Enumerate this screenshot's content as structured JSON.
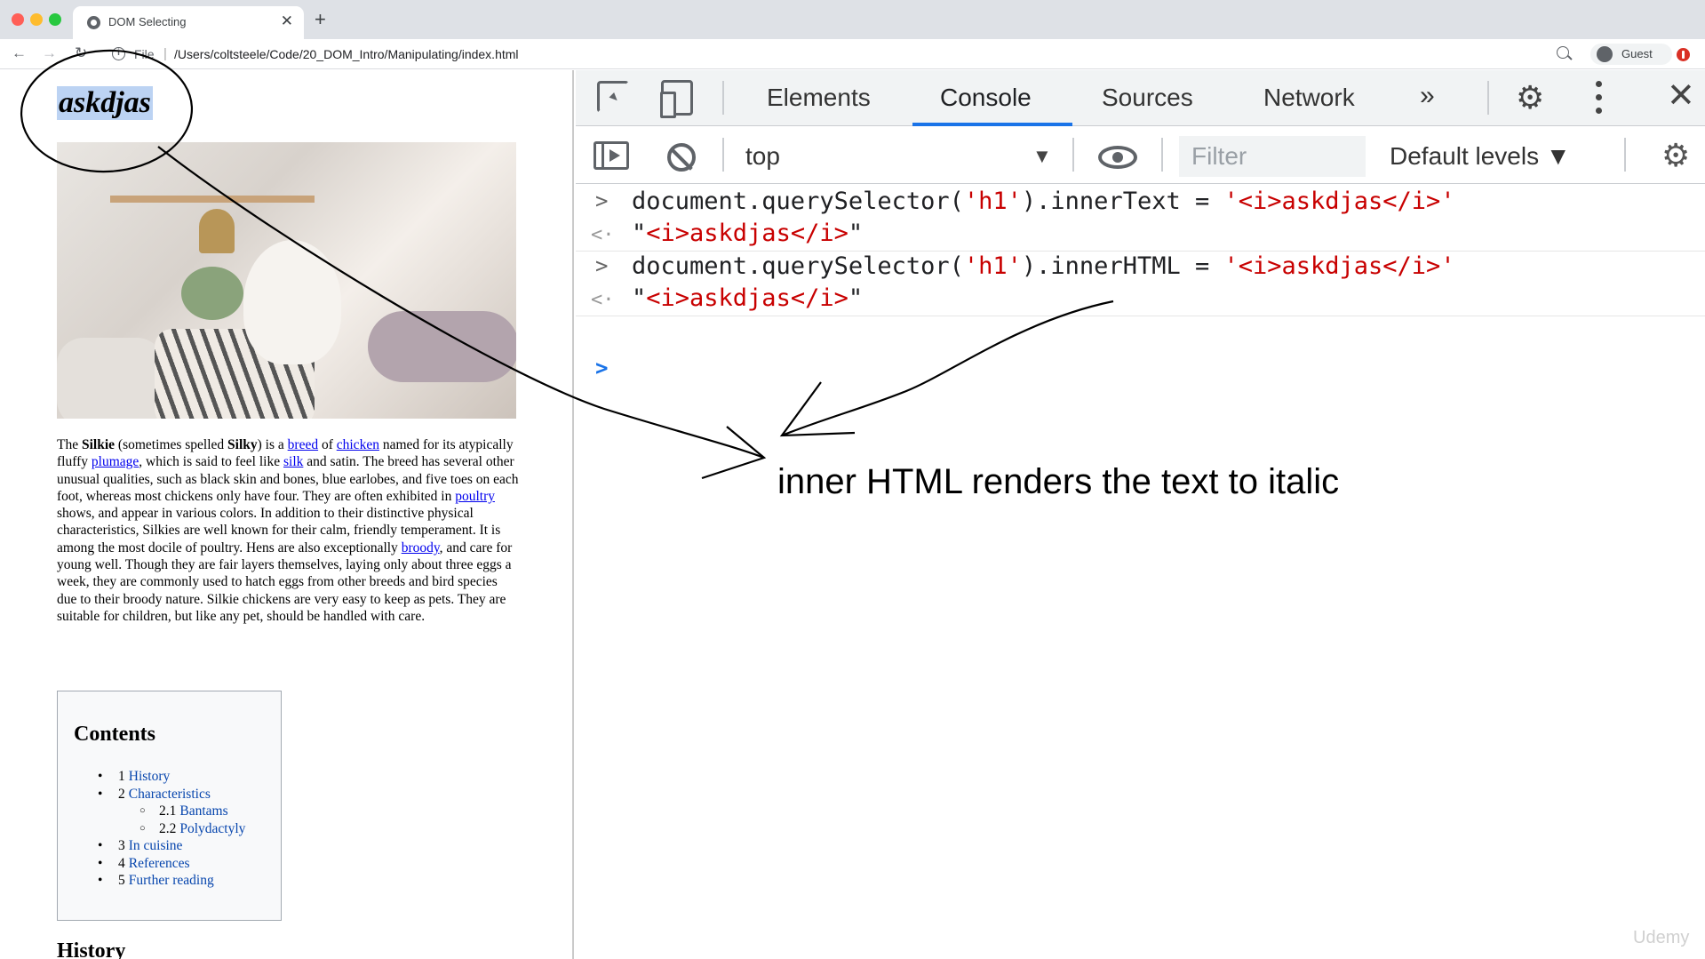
{
  "browser": {
    "tab_title": "DOM Selecting",
    "tab_close": "✕",
    "new_tab": "+",
    "file_label": "File",
    "url": "/Users/coltsteele/Code/20_DOM_Intro/Manipulating/index.html",
    "profile_name": "Guest"
  },
  "page": {
    "h1": "askdjas",
    "article_html": "The <b>Silkie</b> (sometimes spelled <b>Silky</b>) is a <a>breed</a> of <a>chicken</a> named for its atypically fluffy <a>plumage</a>, which is said to feel like <a>silk</a> and satin. The breed has several other unusual qualities, such as black skin and bones, blue earlobes, and five toes on each foot, whereas most chickens only have four. They are often exhibited in <a>poultry</a> shows, and appear in various colors. In addition to their distinctive physical characteristics, Silkies are well known for their calm, friendly temperament. It is among the most docile of poultry. Hens are also exceptionally <a>broody</a>, and care for young well. Though they are fair layers themselves, laying only about three eggs a week, they are commonly used to hatch eggs from other breeds and bird species due to their broody nature. Silkie chickens are very easy to keep as pets. They are suitable for children, but like any pet, should be handled with care.",
    "toc_title": "Contents",
    "toc": [
      {
        "level": 1,
        "num": "1",
        "label": "History"
      },
      {
        "level": 1,
        "num": "2",
        "label": "Characteristics"
      },
      {
        "level": 2,
        "num": "2.1",
        "label": "Bantams"
      },
      {
        "level": 2,
        "num": "2.2",
        "label": "Polydactyly"
      },
      {
        "level": 1,
        "num": "3",
        "label": "In cuisine"
      },
      {
        "level": 1,
        "num": "4",
        "label": "References"
      },
      {
        "level": 1,
        "num": "5",
        "label": "Further reading"
      }
    ],
    "history_heading": "History"
  },
  "devtools": {
    "tabs": [
      "Elements",
      "Console",
      "Sources",
      "Network"
    ],
    "active_tab": "Console",
    "more_tabs": "»",
    "context": "top",
    "filter_placeholder": "Filter",
    "levels": "Default levels ▼",
    "console": [
      {
        "kind": "input",
        "prefix": "document.querySelector(",
        "arg": "'h1'",
        "mid": ").innerText = ",
        "value": "'<i>askdjas</i>'"
      },
      {
        "kind": "output",
        "value": "<i>askdjas</i>"
      },
      {
        "kind": "input",
        "prefix": "document.querySelector(",
        "arg": "'h1'",
        "mid": ").innerHTML = ",
        "value": "'<i>askdjas</i>'"
      },
      {
        "kind": "output",
        "value": "<i>askdjas</i>"
      }
    ]
  },
  "annotation": {
    "text": "inner HTML renders the text to italic",
    "ink_color": "#000000"
  },
  "watermark": "Udemy",
  "colors": {
    "devtools_accent": "#1a73e8",
    "string_red": "#c80000",
    "link_blue": "#0000ee",
    "selection": "#bcd3f3"
  }
}
